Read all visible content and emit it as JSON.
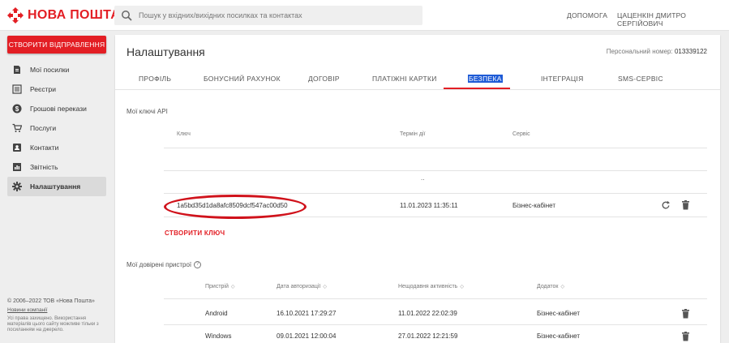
{
  "header": {
    "logo_text": "НОВА ПОШТА",
    "search_placeholder": "Пошук у вхідних/вихідних посилках та контактах",
    "help_label": "ДОПОМОГА",
    "user_name": "ЦАЦЕНКІН ДМИТРО СЕРГІЙОВИЧ"
  },
  "sidebar": {
    "create_button": "СТВОРИТИ ВІДПРАВЛЕННЯ",
    "items": [
      {
        "label": "Мої посилки",
        "icon": "parcel-icon"
      },
      {
        "label": "Реєстри",
        "icon": "registry-icon"
      },
      {
        "label": "Грошові перекази",
        "icon": "money-icon"
      },
      {
        "label": "Послуги",
        "icon": "cart-icon"
      },
      {
        "label": "Контакти",
        "icon": "contacts-icon"
      },
      {
        "label": "Звітність",
        "icon": "report-icon"
      },
      {
        "label": "Налаштування",
        "icon": "gear-icon",
        "active": true
      }
    ],
    "footer": {
      "copyright": "© 2006–2022 ТОВ «Нова Пошта»",
      "link": "Новини компанії",
      "note": "Усі права захищено. Використання матеріалів цього сайту можливе тільки з посиланням на джерело."
    }
  },
  "main": {
    "title": "Налаштування",
    "personal_number_label": "Персональний номер:",
    "personal_number": "013339122",
    "tabs": [
      {
        "label": "ПРОФІЛЬ"
      },
      {
        "label": "БОНУСНИЙ РАХУНОК"
      },
      {
        "label": "ДОГОВІР"
      },
      {
        "label": "ПЛАТІЖНІ КАРТКИ"
      },
      {
        "label": "БЕЗПЕКА",
        "active": true
      },
      {
        "label": "ІНТЕГРАЦІЯ"
      },
      {
        "label": "SMS-СЕРВІС"
      }
    ],
    "api_keys": {
      "section_label": "Мої ключі API",
      "headers": {
        "key": "Ключ",
        "term": "Термін дії",
        "service": "Сервіс"
      },
      "placeholder_row": "..",
      "rows": [
        {
          "key": "1a5bd35d1da8afc8509dcf547ac00d50",
          "term": "11.01.2023 11:35:11",
          "service": "Бізнес-кабінет"
        }
      ],
      "create_button": "СТВОРИТИ КЛЮЧ"
    },
    "devices": {
      "section_label": "Мої довірені пристрої",
      "headers": {
        "device": "Пристрій",
        "auth_date": "Дата авторизації",
        "last_activity": "Нещодавня активність",
        "app": "Додаток"
      },
      "rows": [
        {
          "device": "Android",
          "auth_date": "16.10.2021 17:29:27",
          "last_activity": "11.01.2022 22:02:39",
          "app": "Бізнес-кабінет"
        },
        {
          "device": "Windows",
          "auth_date": "09.01.2021 12:00:04",
          "last_activity": "27.01.2022 12:21:59",
          "app": "Бізнес-кабінет"
        }
      ]
    }
  },
  "colors": {
    "brand": "#e31e24",
    "highlight": "#1e5bd6",
    "annotation": "#d0121b"
  }
}
